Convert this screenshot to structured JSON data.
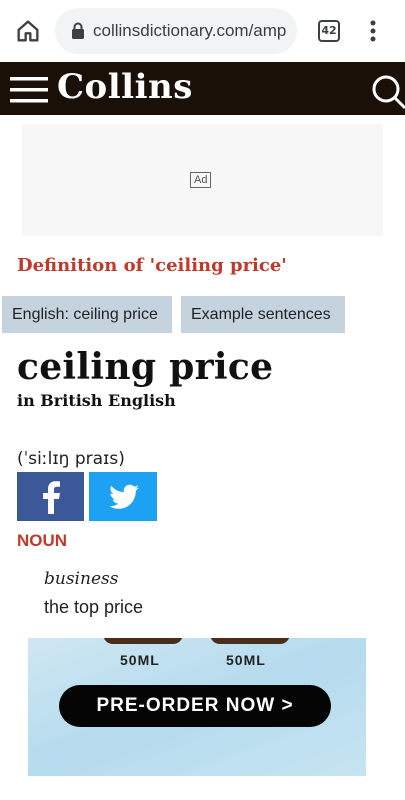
{
  "browser": {
    "url": "collinsdictionary.com/amp",
    "tab_count": "42"
  },
  "header": {
    "logo": "Collins"
  },
  "ad": {
    "label": "Ad"
  },
  "page": {
    "definition_title": "Definition of  'ceiling price'",
    "tabs": [
      {
        "label": "English: ceiling price"
      },
      {
        "label": "Example sentences"
      }
    ],
    "headword": "ceiling price",
    "subhead": "in British English",
    "pronunciation": "(ˈsiːlɪŋ praɪs)",
    "part_of_speech": "NOUN",
    "domain": "business",
    "definition": "the top price"
  },
  "promo": {
    "size1": "50ML",
    "size2": "50ML",
    "cta": "PRE-ORDER NOW >"
  },
  "colors": {
    "header_bg": "#1a1008",
    "accent_red": "#c0392b",
    "facebook": "#3b5998",
    "twitter": "#1da1f2"
  }
}
